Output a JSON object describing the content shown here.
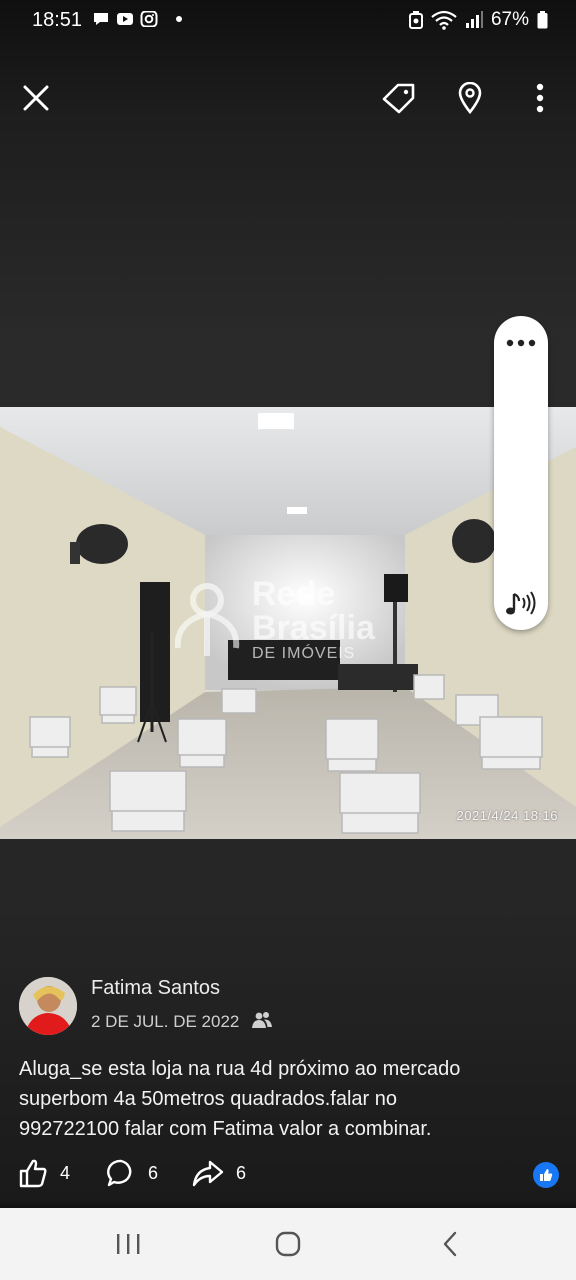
{
  "status_bar": {
    "time": "18:51",
    "battery": "67%",
    "left_icons": [
      "chat-bubble-icon",
      "youtube-icon",
      "instagram-icon"
    ],
    "right_icons": [
      "vpn-icon",
      "wifi-icon",
      "signal-icon",
      "battery-icon"
    ]
  },
  "toolbar": {
    "icons": [
      "close-icon",
      "tag-icon",
      "location-pin-icon",
      "more-vertical-icon"
    ]
  },
  "photo": {
    "timestamp": "2021/4/24 18:16",
    "watermark": {
      "line1": "Rede",
      "line2": "Brasília",
      "line3": "DE IMÓVEIS"
    }
  },
  "post": {
    "author": "Fatima Santos",
    "date": "2 DE JUL. DE 2022",
    "caption": "Aluga_se esta loja na rua 4d próximo ao mercado\nsuperbom 4a 50metros quadrados.falar no\n992722100 falar com Fatima valor a  combinar.",
    "likes": "4",
    "comments": "6",
    "shares": "6"
  },
  "colors": {
    "accent": "#1877f2",
    "background": "#262626",
    "nav_bar": "#f3f3f3"
  }
}
